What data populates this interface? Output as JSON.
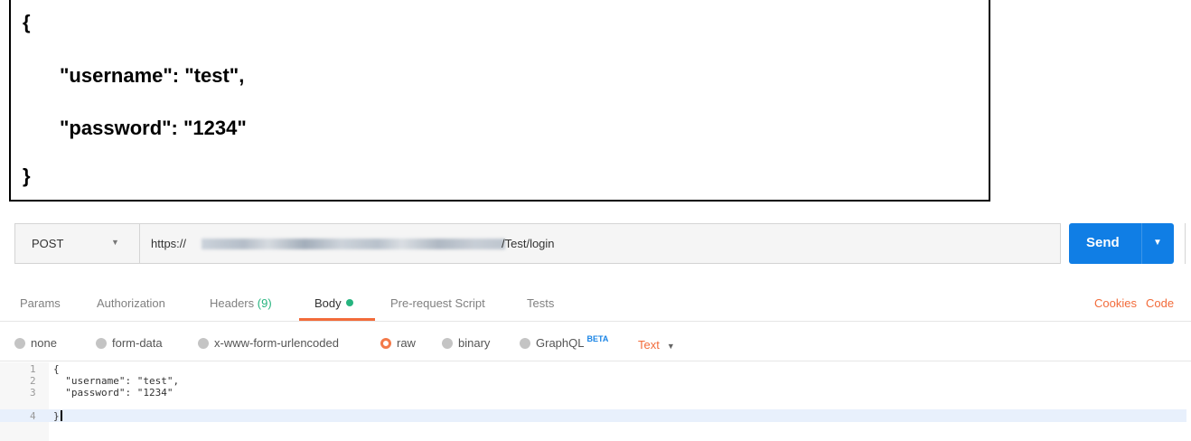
{
  "json_box": {
    "lines": [
      "{",
      "\"username\": \"test\",",
      "\"password\": \"1234\"",
      "}"
    ]
  },
  "request": {
    "method": "POST",
    "url_prefix": "https://",
    "url_suffix": "/Test/login",
    "send_label": "Send"
  },
  "tabs": [
    {
      "label": "Params"
    },
    {
      "label": "Authorization"
    },
    {
      "label": "Headers",
      "count": "(9)"
    },
    {
      "label": "Body"
    },
    {
      "label": "Pre-request Script"
    },
    {
      "label": "Tests"
    }
  ],
  "right_links": {
    "cookies": "Cookies",
    "code": "Code"
  },
  "body_types": [
    {
      "label": "none"
    },
    {
      "label": "form-data"
    },
    {
      "label": "x-www-form-urlencoded"
    },
    {
      "label": "raw"
    },
    {
      "label": "binary"
    },
    {
      "label": "GraphQL",
      "badge": "BETA"
    }
  ],
  "content_type": "Text",
  "editor": {
    "line_numbers": [
      "1",
      "2",
      "3",
      "4"
    ],
    "lines": [
      "{",
      "  \"username\": \"test\",",
      "  \"password\": \"1234\"",
      "}"
    ]
  },
  "colors": {
    "accent": "#f26b3a",
    "send": "#107ee5",
    "headers_count": "#26b47f",
    "beta": "#1a84e5"
  }
}
